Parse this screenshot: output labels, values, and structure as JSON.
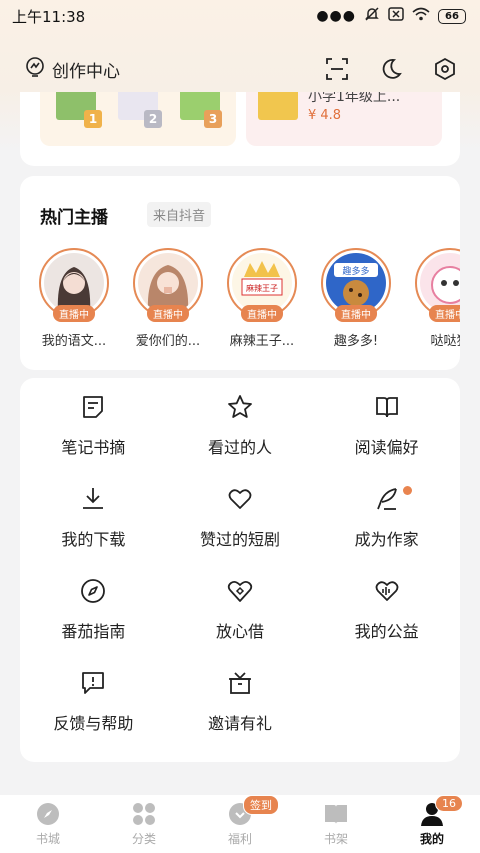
{
  "status_bar": {
    "time": "上午11:38",
    "battery": "66"
  },
  "header": {
    "title": "创作中心"
  },
  "promo": {
    "left_tags": [
      "1",
      "2",
      "3"
    ],
    "right_title": "小学1年级上...",
    "right_rating": "¥ 4.8"
  },
  "anchors": {
    "title": "热门主播",
    "source": "来自抖音",
    "live_label": "直播中",
    "items": [
      {
        "name": "我的语文..."
      },
      {
        "name": "爱你们的..."
      },
      {
        "name": "麻辣王子..."
      },
      {
        "name": "趣多多!"
      },
      {
        "name": "哒哒猫"
      }
    ],
    "logo_text": [
      "麻辣王子",
      "趣多多"
    ]
  },
  "features": [
    {
      "label": "笔记书摘",
      "icon": "note-icon"
    },
    {
      "label": "看过的人",
      "icon": "star-icon"
    },
    {
      "label": "阅读偏好",
      "icon": "book-open-icon"
    },
    {
      "label": "我的下载",
      "icon": "download-icon"
    },
    {
      "label": "赞过的短剧",
      "icon": "heart-icon"
    },
    {
      "label": "成为作家",
      "icon": "quill-icon"
    },
    {
      "label": "番茄指南",
      "icon": "compass-icon"
    },
    {
      "label": "放心借",
      "icon": "diamond-heart-icon"
    },
    {
      "label": "我的公益",
      "icon": "heart-pulse-icon"
    },
    {
      "label": "反馈与帮助",
      "icon": "feedback-icon"
    },
    {
      "label": "邀请有礼",
      "icon": "gift-icon"
    }
  ],
  "tabs": [
    {
      "label": "书城",
      "icon": "compass-icon"
    },
    {
      "label": "分类",
      "icon": "grid-icon"
    },
    {
      "label": "福利",
      "icon": "reward-icon",
      "badge": "签到"
    },
    {
      "label": "书架",
      "icon": "bookshelf-icon"
    },
    {
      "label": "我的",
      "icon": "person-icon",
      "badge": "16",
      "active": true
    }
  ],
  "colors": {
    "accent": "#e7844f",
    "background": "#f3f3f4"
  }
}
